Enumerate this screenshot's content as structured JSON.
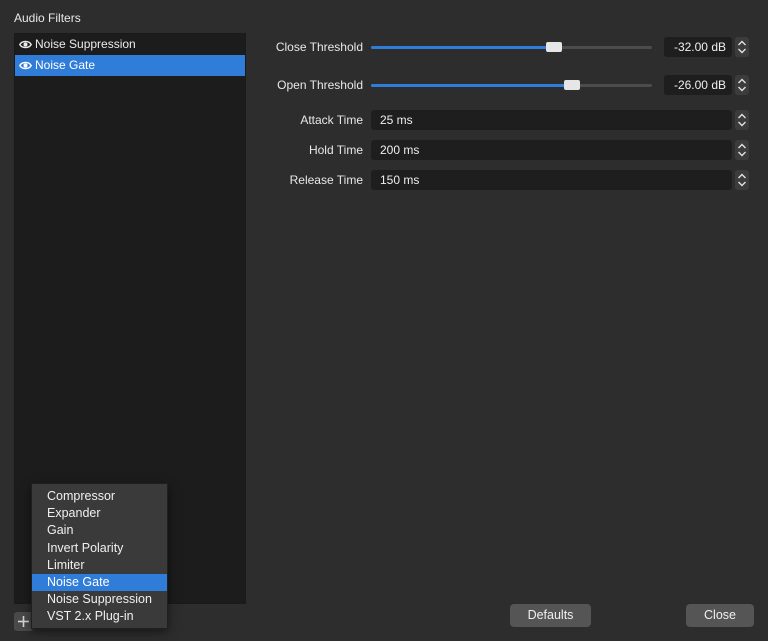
{
  "window": {
    "section_title": "Audio Filters"
  },
  "filters": {
    "items": [
      {
        "label": "Noise Suppression",
        "icon": "eye-icon",
        "enabled": true,
        "selected": false
      },
      {
        "label": "Noise Gate",
        "icon": "eye-icon",
        "enabled": true,
        "selected": true
      }
    ],
    "add_icon": "plus-icon"
  },
  "add_menu": {
    "items": [
      "Compressor",
      "Expander",
      "Gain",
      "Invert Polarity",
      "Limiter",
      "Noise Gate",
      "Noise Suppression",
      "VST 2.x Plug-in"
    ],
    "highlighted": "Noise Gate"
  },
  "properties": {
    "close_threshold": {
      "label": "Close Threshold",
      "value": "-32.00 dB",
      "slider_fraction": 0.65
    },
    "open_threshold": {
      "label": "Open Threshold",
      "value": "-26.00 dB",
      "slider_fraction": 0.715
    },
    "attack_time": {
      "label": "Attack Time",
      "value": "25 ms"
    },
    "hold_time": {
      "label": "Hold Time",
      "value": "200 ms"
    },
    "release_time": {
      "label": "Release Time",
      "value": "150 ms"
    }
  },
  "buttons": {
    "defaults": "Defaults",
    "close": "Close"
  },
  "colors": {
    "accent": "#2f7dd8",
    "background": "#2d2d2d",
    "list_background": "#1c1c1c"
  }
}
